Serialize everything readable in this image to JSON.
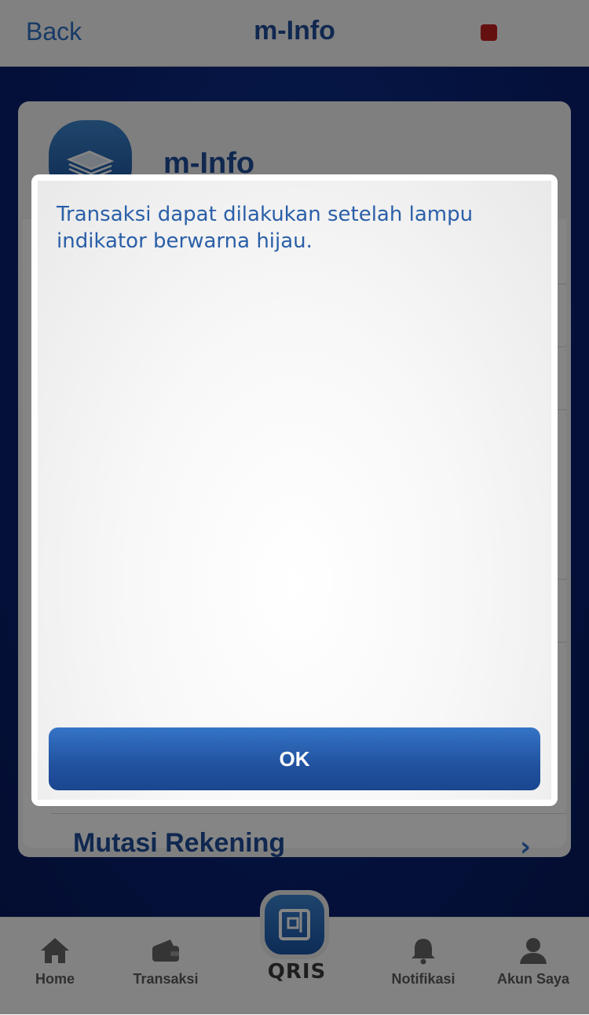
{
  "nav": {
    "back_label": "Back",
    "title": "m-Info",
    "status_light_color": "#c22020"
  },
  "card": {
    "title": "m-Info",
    "icon": "card-stack-icon",
    "partial_item_label": "Mutasi Rekening"
  },
  "dialog": {
    "message": "Transaksi dapat dilakukan setelah lampu indikator berwarna hijau.",
    "ok_label": "OK"
  },
  "tabbar": {
    "items": [
      {
        "label": "Home",
        "icon": "home-icon"
      },
      {
        "label": "Transaksi",
        "icon": "wallet-icon"
      },
      {
        "label": "Notifikasi",
        "icon": "bell-icon"
      },
      {
        "label": "Akun Saya",
        "icon": "person-icon"
      }
    ],
    "qris_label": "QRIS"
  },
  "colors": {
    "accent": "#1f4e9a",
    "link": "#2f6fc4",
    "background": "#0a1f66"
  }
}
